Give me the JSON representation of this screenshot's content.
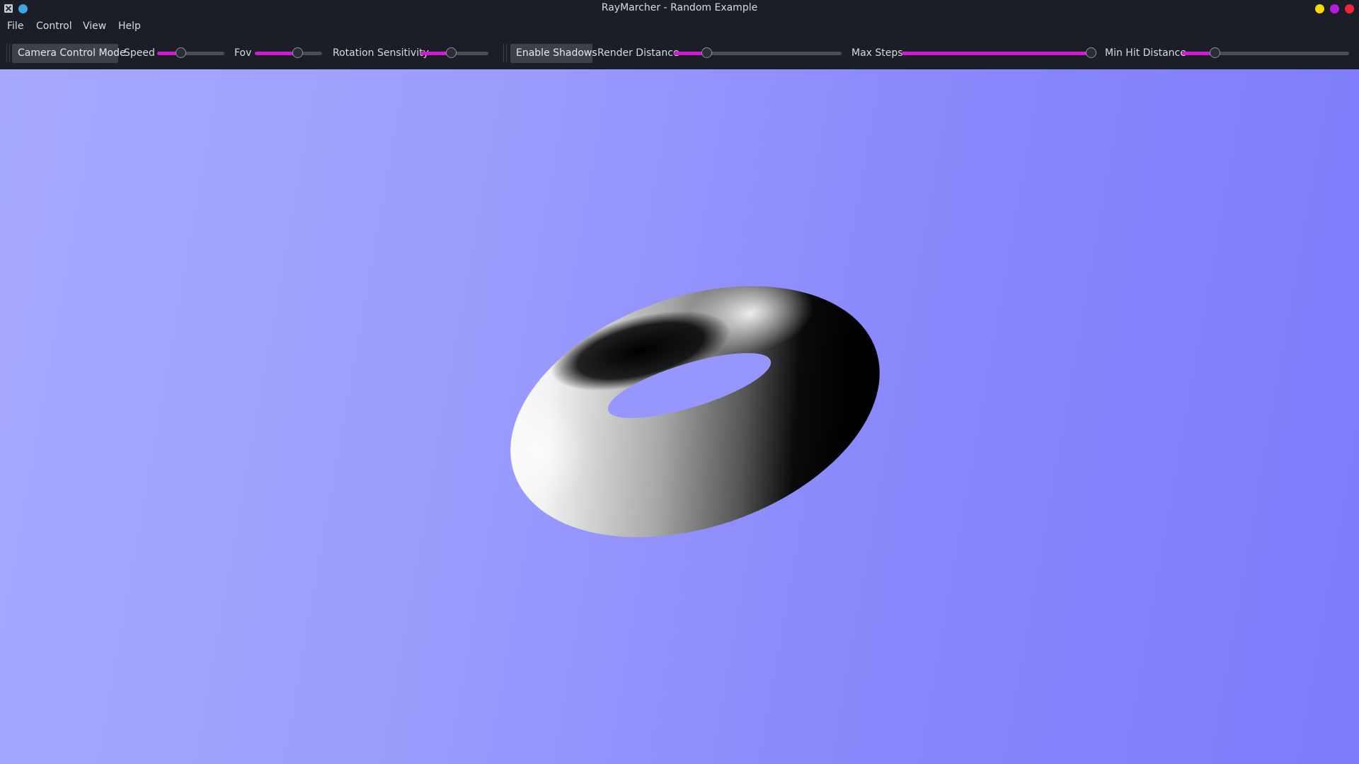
{
  "window": {
    "title": "RayMarcher - Random Example",
    "controls": {
      "minimize_color": "#f5d90a",
      "maximize_color": "#b81ae0",
      "close_color": "#f0243d"
    },
    "pin_color": "#3ba6e0"
  },
  "menu": {
    "items": [
      "File",
      "Control",
      "View",
      "Help"
    ]
  },
  "toolbar": {
    "camera_mode_label": "Camera Control Mode",
    "speed_label": "Speed",
    "speed_value": 0.36,
    "fov_label": "Fov",
    "fov_value": 0.64,
    "rotation_label": "Rotation Sensitivity",
    "rotation_value": 0.46,
    "shadows_label": "Enable Shadows",
    "render_distance_label": "Render Distance",
    "render_distance_value": 0.2,
    "max_steps_label": "Max Steps",
    "max_steps_value": 0.99,
    "min_hit_label": "Min Hit Distance",
    "min_hit_value": 0.2,
    "accent_color": "#d41ad6"
  },
  "viewport": {
    "background_left": "#a7a8fd",
    "background_right": "#7d7bfa",
    "object": "torus"
  }
}
